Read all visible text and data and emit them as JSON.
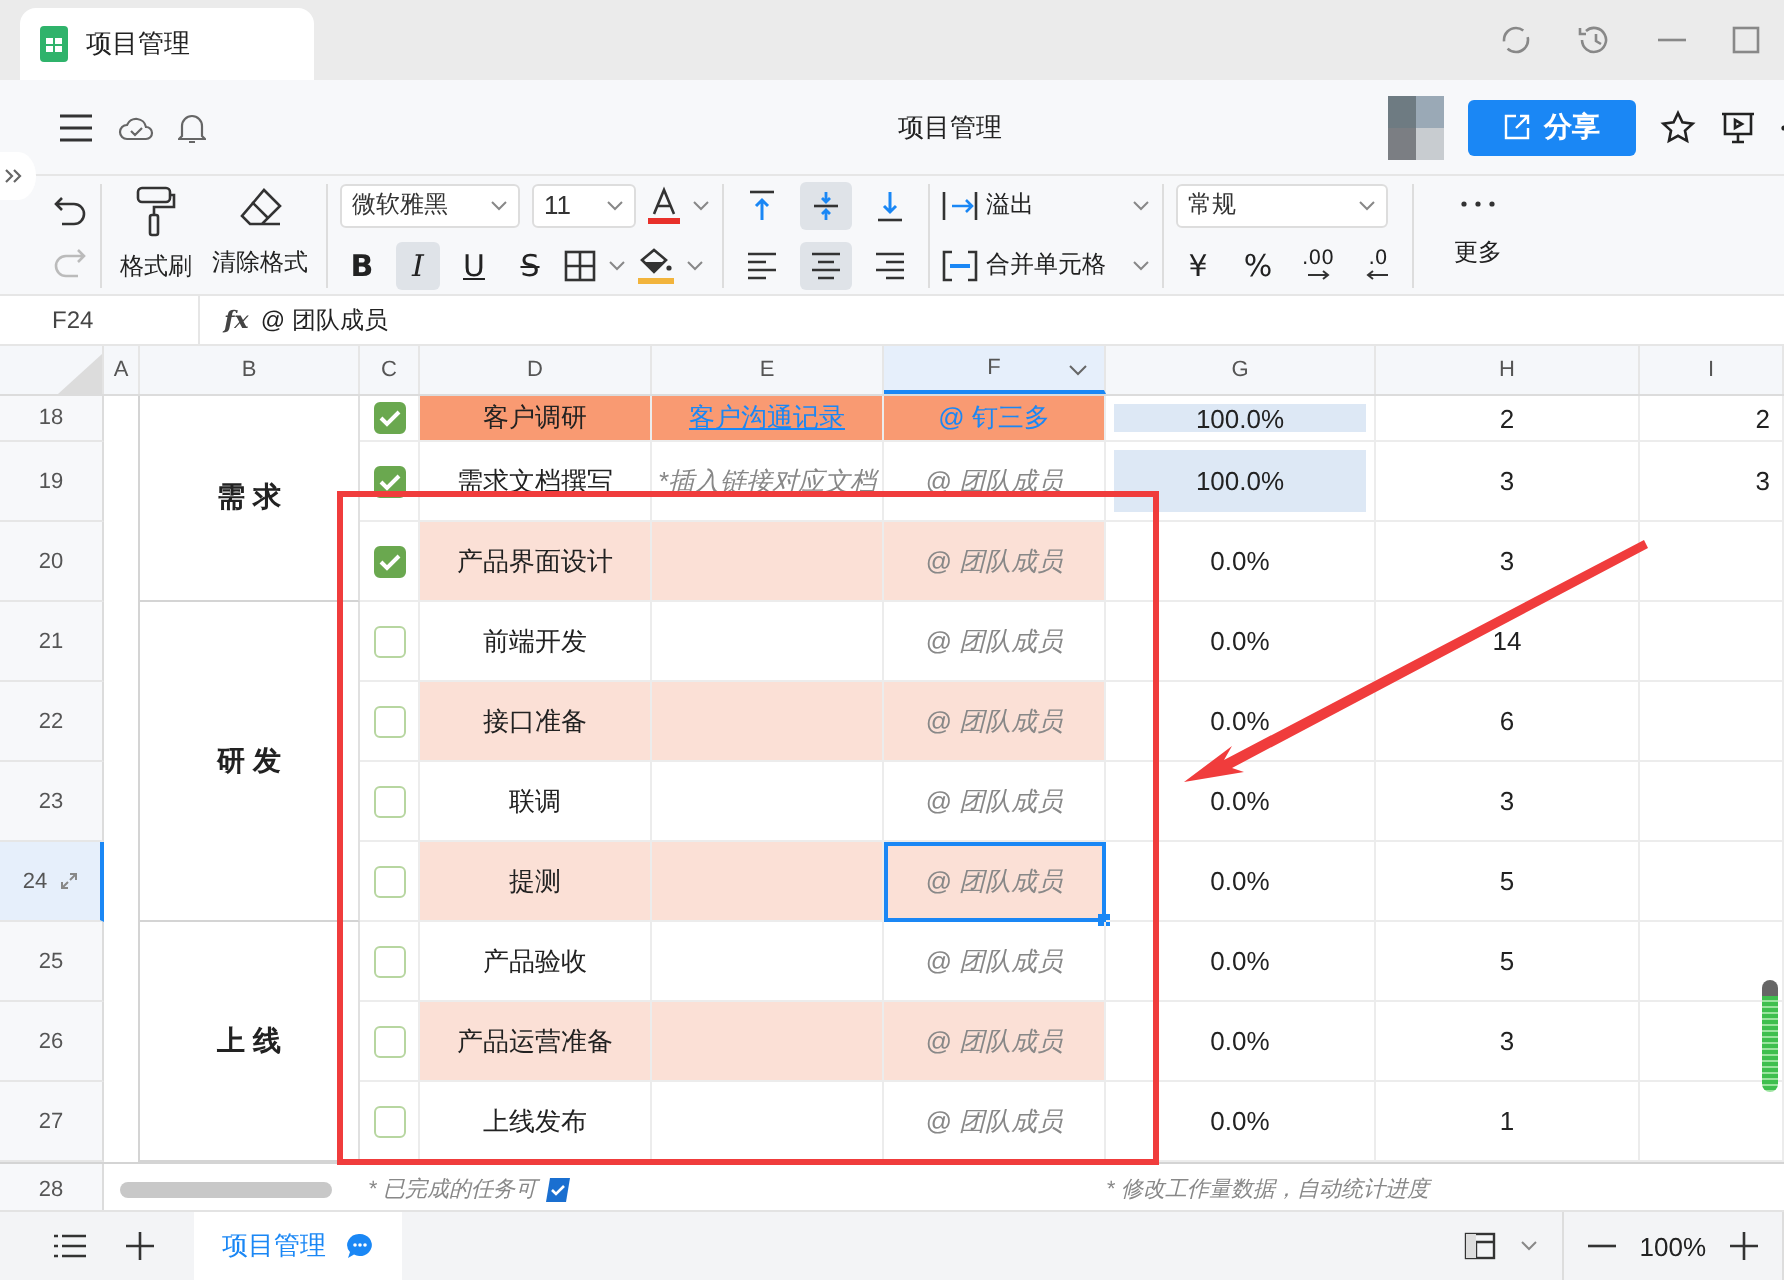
{
  "window": {
    "tab_title": "项目管理"
  },
  "header": {
    "title": "项目管理",
    "share_label": "分享"
  },
  "toolbar": {
    "format_painter": "格式刷",
    "clear_format": "清除格式",
    "font": "微软雅黑",
    "size": "11",
    "styles": [
      {
        "kind": "bold",
        "label": "B",
        "selected": false
      },
      {
        "kind": "italic",
        "label": "I",
        "selected": true
      },
      {
        "kind": "underline",
        "label": "U",
        "selected": false
      },
      {
        "kind": "strike",
        "label": "S",
        "selected": false
      }
    ],
    "valign": [
      {
        "kind": "top",
        "selected": false
      },
      {
        "kind": "middle",
        "selected": true
      },
      {
        "kind": "bottom",
        "selected": false
      }
    ],
    "halign": [
      {
        "kind": "left",
        "selected": false
      },
      {
        "kind": "center",
        "selected": true
      },
      {
        "kind": "right",
        "selected": false
      }
    ],
    "wrap": "溢出",
    "merge": "合并单元格",
    "number_format": "常规",
    "currency": "¥",
    "percent": "%",
    "add_decimal": ".00",
    "remove_decimal": ".0",
    "more": "更多"
  },
  "formula_bar": {
    "cell": "F24",
    "fx": "fx",
    "value": "@ 团队成员"
  },
  "columns": [
    {
      "label": "A",
      "selected": false
    },
    {
      "label": "B",
      "selected": false
    },
    {
      "label": "C",
      "selected": false
    },
    {
      "label": "D",
      "selected": false
    },
    {
      "label": "E",
      "selected": false
    },
    {
      "label": "F",
      "selected": true
    },
    {
      "label": "G",
      "selected": false
    },
    {
      "label": "H",
      "selected": false
    },
    {
      "label": "I",
      "selected": false
    }
  ],
  "groups": [
    {
      "label": "需 求",
      "rows": [
        {
          "number": "18",
          "selected": false,
          "done": true,
          "task": "客户调研",
          "color": "#f99a72",
          "doc": {
            "kind": "link",
            "text": "客户沟通记录"
          },
          "owner": {
            "kind": "mention",
            "text": "@ 钉三多"
          },
          "progress": "100.0%",
          "progress_highlight": true,
          "hours": "2",
          "col_i": "2"
        },
        {
          "number": "19",
          "selected": false,
          "done": true,
          "task": "需求文档撰写",
          "doc": {
            "kind": "hint",
            "text": "*插入链接对应文档"
          },
          "owner": {
            "kind": "hint",
            "text": "@ 团队成员"
          },
          "progress": "100.0%",
          "progress_highlight": true,
          "hours": "3",
          "col_i": "3"
        },
        {
          "number": "20",
          "selected": false,
          "done": true,
          "task": "产品界面设计",
          "color": "#fbe0d6",
          "owner": {
            "kind": "hint",
            "text": "@ 团队成员"
          },
          "progress": "0.0%",
          "progress_highlight": false,
          "hours": "3"
        }
      ]
    },
    {
      "label": "研 发",
      "rows": [
        {
          "number": "21",
          "selected": false,
          "done": false,
          "task": "前端开发",
          "owner": {
            "kind": "hint",
            "text": "@ 团队成员"
          },
          "progress": "0.0%",
          "progress_highlight": false,
          "hours": "14"
        },
        {
          "number": "22",
          "selected": false,
          "done": false,
          "task": "接口准备",
          "color": "#fbe0d6",
          "owner": {
            "kind": "hint",
            "text": "@ 团队成员"
          },
          "progress": "0.0%",
          "progress_highlight": false,
          "hours": "6"
        },
        {
          "number": "23",
          "selected": false,
          "done": false,
          "task": "联调",
          "owner": {
            "kind": "hint",
            "text": "@ 团队成员"
          },
          "progress": "0.0%",
          "progress_highlight": false,
          "hours": "3"
        },
        {
          "number": "24",
          "selected": true,
          "done": false,
          "task": "提测",
          "color": "#fbe0d6",
          "owner": {
            "kind": "hint",
            "text": "@ 团队成员"
          },
          "progress": "0.0%",
          "progress_highlight": false,
          "hours": "5"
        }
      ]
    },
    {
      "label": "上 线",
      "rows": [
        {
          "number": "25",
          "selected": false,
          "done": false,
          "task": "产品验收",
          "owner": {
            "kind": "hint",
            "text": "@ 团队成员"
          },
          "progress": "0.0%",
          "progress_highlight": false,
          "hours": "5"
        },
        {
          "number": "26",
          "selected": false,
          "done": false,
          "task": "产品运营准备",
          "color": "#fbe0d6",
          "owner": {
            "kind": "hint",
            "text": "@ 团队成员"
          },
          "progress": "0.0%",
          "progress_highlight": false,
          "hours": "3"
        },
        {
          "number": "27",
          "selected": false,
          "done": false,
          "task": "上线发布",
          "owner": {
            "kind": "hint",
            "text": "@ 团队成员"
          },
          "progress": "0.0%",
          "progress_highlight": false,
          "hours": "1"
        }
      ]
    }
  ],
  "footer_row": {
    "number": "28",
    "notes": [
      "* 已完成的任务可",
      "* 修改工作量数据，自动统计进度"
    ]
  },
  "bottom_bar": {
    "sheets": [
      {
        "label": "项目管理",
        "selected": true
      }
    ],
    "zoom": "100%"
  }
}
